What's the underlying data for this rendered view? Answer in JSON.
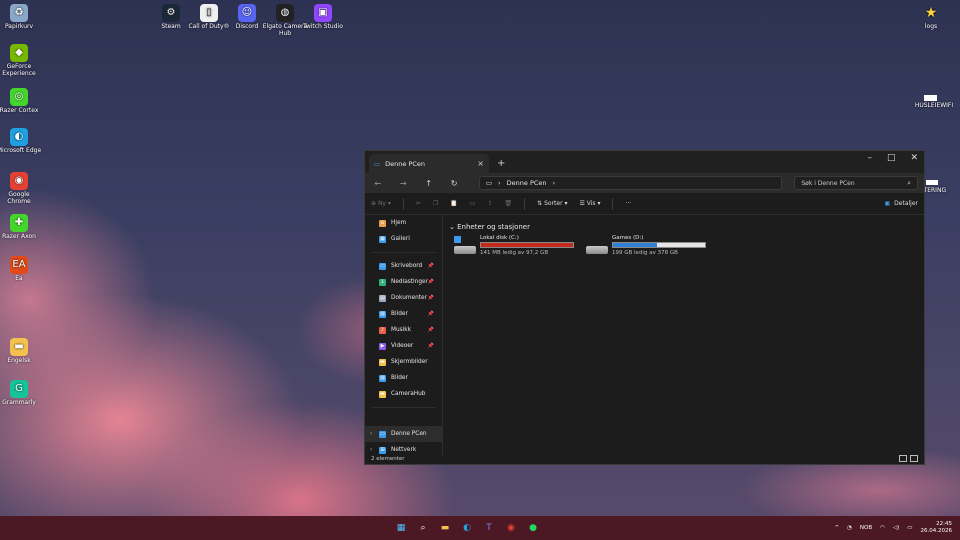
{
  "desktop": {
    "icons_left": [
      {
        "label": "Papirkurv",
        "icon": "recycle-bin-icon",
        "color": "#8aa6c8"
      },
      {
        "label": "GeForce Experience",
        "icon": "geforce-icon",
        "color": "#76b900"
      },
      {
        "label": "Razer Cortex",
        "icon": "razer-cortex-icon",
        "color": "#44d62c"
      },
      {
        "label": "Microsoft Edge",
        "icon": "edge-icon",
        "color": "#1fa0e0"
      },
      {
        "label": "Google Chrome",
        "icon": "chrome-icon",
        "color": "#e44133"
      },
      {
        "label": "Razer Axon",
        "icon": "razer-axon-icon",
        "color": "#44d62c"
      },
      {
        "label": "Ea",
        "icon": "ea-icon",
        "color": "#e24a1a"
      },
      {
        "label": "Engelsk",
        "icon": "folder-icon",
        "color": "#f2c14e"
      },
      {
        "label": "Grammarly",
        "icon": "grammarly-icon",
        "color": "#15c39a"
      }
    ],
    "icons_top": [
      {
        "label": "Steam",
        "icon": "steam-icon",
        "color": "#1b2838"
      },
      {
        "label": "Call of Duty®",
        "icon": "file-icon",
        "color": "#f0f0f0"
      },
      {
        "label": "Discord",
        "icon": "discord-icon",
        "color": "#5865f2"
      },
      {
        "label": "Elgato Camera Hub",
        "icon": "camera-hub-icon",
        "color": "#222222"
      },
      {
        "label": "Twitch Studio",
        "icon": "twitch-icon",
        "color": "#9146ff"
      }
    ],
    "icon_right": {
      "label": "logs",
      "icon": "star-icon",
      "color": "#ffd23f"
    },
    "label_wifi": "HUSLEIEWIFI",
    "label_partial": "TTERING"
  },
  "explorer": {
    "tab_title": "Denne PCen",
    "address": "Denne PCen",
    "search_placeholder": "Søk i Denne PCen",
    "toolbar": {
      "new_label": "Ny",
      "sort_label": "Sorter",
      "view_label": "Vis",
      "more_label": "···",
      "details_label": "Detaljer"
    },
    "nav": {
      "top": [
        {
          "label": "Hjem",
          "icon": "home-icon",
          "color": "#e8a050"
        },
        {
          "label": "Galleri",
          "icon": "gallery-icon",
          "color": "#3b9bea"
        }
      ],
      "pinned": [
        {
          "label": "Skrivebord",
          "icon": "desktop-folder-icon",
          "color": "#3b9bea",
          "pin": "📌"
        },
        {
          "label": "Nedlastinger",
          "icon": "download-icon",
          "color": "#2fb07c",
          "pin": "📌"
        },
        {
          "label": "Dokumenter",
          "icon": "document-icon",
          "color": "#9aa6b8",
          "pin": "📌"
        },
        {
          "label": "Bilder",
          "icon": "pictures-icon",
          "color": "#3b9bea",
          "pin": "📌"
        },
        {
          "label": "Musikk",
          "icon": "music-icon",
          "color": "#e8604a",
          "pin": "📌"
        },
        {
          "label": "Videoer",
          "icon": "video-icon",
          "color": "#8a5ce8",
          "pin": "📌"
        },
        {
          "label": "Skjermbilder",
          "icon": "folder-icon",
          "color": "#f2c14e",
          "pin": ""
        },
        {
          "label": "Bilder",
          "icon": "pictures-icon",
          "color": "#3b9bea",
          "pin": ""
        },
        {
          "label": "CameraHub",
          "icon": "folder-icon",
          "color": "#f2c14e",
          "pin": ""
        }
      ],
      "bottom": [
        {
          "label": "Denne PCen",
          "icon": "pc-icon",
          "color": "#3b9bea",
          "selected": true
        },
        {
          "label": "Nettverk",
          "icon": "network-icon",
          "color": "#3b9bea",
          "selected": false
        }
      ]
    },
    "group_header": "Enheter og stasjoner",
    "drives": [
      {
        "name": "Lokal disk (C:)",
        "usage": "141 MB ledig av 97,2 GB",
        "fill_pct": 99.8,
        "bar_color": "#c42b1c",
        "has_win_logo": true
      },
      {
        "name": "Games (D:)",
        "usage": "199 GB ledig av 378 GB",
        "fill_pct": 47.4,
        "bar_color": "#2f7fd4",
        "has_win_logo": false
      }
    ],
    "status": "2 elementer"
  },
  "taskbar": {
    "apps": [
      {
        "icon": "windows-start-icon",
        "glyph": "▦",
        "color": "#4cc2ff"
      },
      {
        "icon": "search-icon",
        "glyph": "⌕",
        "color": "#ffffff"
      },
      {
        "icon": "file-explorer-icon",
        "glyph": "▬",
        "color": "#f2c14e"
      },
      {
        "icon": "edge-icon",
        "glyph": "◐",
        "color": "#1fa0e0"
      },
      {
        "icon": "teams-icon",
        "glyph": "T",
        "color": "#7b83eb"
      },
      {
        "icon": "chrome-icon",
        "glyph": "◉",
        "color": "#e44133"
      },
      {
        "icon": "spotify-icon",
        "glyph": "●",
        "color": "#1ed760"
      }
    ],
    "tray": {
      "chevron": "^",
      "lang": "NOB",
      "time": "22:45",
      "date": "26.04.2026"
    }
  }
}
